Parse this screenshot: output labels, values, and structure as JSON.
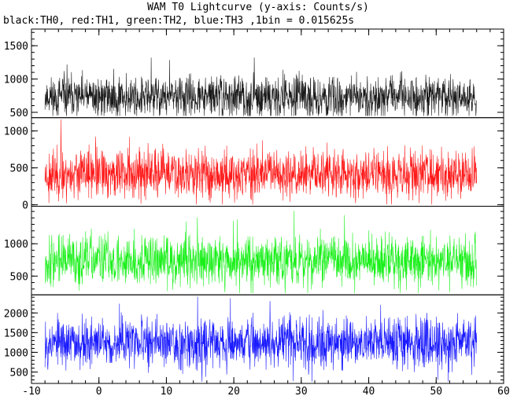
{
  "chart_data": {
    "type": "line",
    "title": "WAM T0 Lightcurve (y-axis: Counts/s)",
    "subtitle": "black:TH0, red:TH1, green:TH2, blue:TH3 ,1bin = 0.015625s",
    "xlim": [
      -10,
      60
    ],
    "x_ticks": [
      "-10",
      "0",
      "10",
      "20",
      "30",
      "40",
      "50",
      "60"
    ],
    "x_range_data": [
      -8,
      56
    ],
    "series": [
      {
        "name": "TH0",
        "color": "#000000",
        "ylim": [
          420,
          1750
        ],
        "mean": 730,
        "spread": 150,
        "yticks": [
          500,
          1000,
          1500
        ],
        "seed": 11
      },
      {
        "name": "TH1",
        "color": "#ff0000",
        "ylim": [
          -20,
          1180
        ],
        "mean": 420,
        "spread": 160,
        "yticks": [
          0,
          500,
          1000
        ],
        "seed": 23
      },
      {
        "name": "TH2",
        "color": "#00ee00",
        "ylim": [
          210,
          1580
        ],
        "mean": 740,
        "spread": 190,
        "yticks": [
          500,
          1000
        ],
        "seed": 37
      },
      {
        "name": "TH3",
        "color": "#0000ff",
        "ylim": [
          210,
          2460
        ],
        "mean": 1250,
        "spread": 300,
        "yticks": [
          500,
          1000,
          1500,
          2000
        ],
        "seed": 53
      }
    ]
  }
}
